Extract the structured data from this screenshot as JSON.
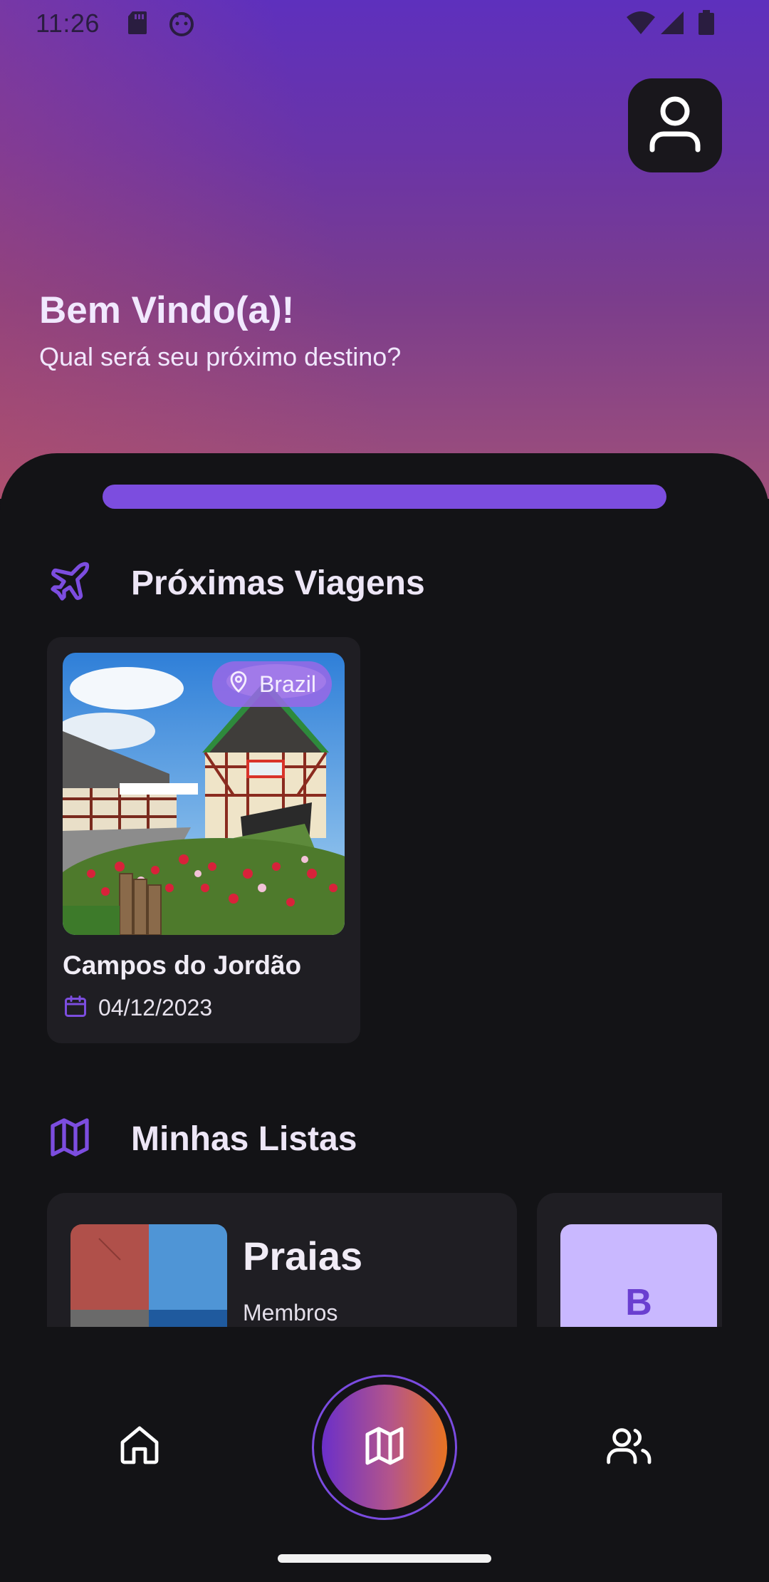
{
  "status_bar": {
    "time": "11:26",
    "icons": [
      "sd-card-icon",
      "android-debug-icon",
      "wifi-icon",
      "cellular-signal-icon",
      "battery-icon"
    ]
  },
  "header": {
    "profile_icon": "user-icon",
    "welcome": "Bem Vindo(a)!",
    "subtitle": "Qual será seu próximo destino?"
  },
  "sheet": {
    "progress_fraction": 1.0
  },
  "upcoming_trips": {
    "icon": "airplane-icon",
    "title": "Próximas Viagens",
    "trips": [
      {
        "name": "Campos do Jordão",
        "country": "Brazil",
        "date": "04/12/2023",
        "image_desc": "photo of a half-timbered building with a green roof"
      }
    ]
  },
  "my_lists": {
    "icon": "map-icon",
    "title": "Minhas Listas",
    "lists": [
      {
        "title": "Praias",
        "members_label": "Membros"
      },
      {
        "letter": "B"
      }
    ]
  },
  "bottom_nav": {
    "items": [
      {
        "name": "home",
        "icon": "home-icon"
      },
      {
        "name": "map",
        "icon": "map-icon"
      },
      {
        "name": "people",
        "icon": "users-icon"
      }
    ]
  },
  "colors": {
    "accent": "#7c4ddf",
    "background": "#131316",
    "card": "#1f1e23",
    "hero_top": "#5e30bd",
    "hero_bottom": "#a0507a",
    "nav_gradient_start": "#6b2fc9",
    "nav_gradient_end": "#e87322"
  }
}
